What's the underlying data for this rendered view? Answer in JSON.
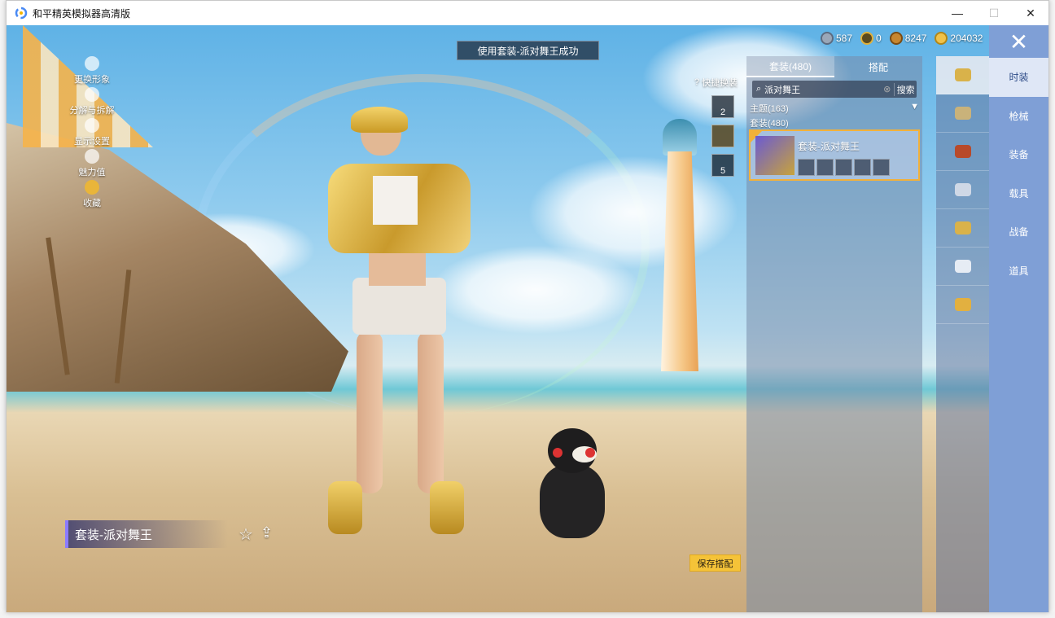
{
  "window": {
    "title": "和平精英模拟器高清版",
    "minimize": "—",
    "maximize": "☐",
    "close": "✕"
  },
  "toast": "使用套装-派对舞王成功",
  "currency": [
    {
      "icon": "silver-coin-icon",
      "value": "587",
      "color": "#9aa7b8"
    },
    {
      "icon": "bp-coin-icon",
      "value": "0",
      "color": "#e0b03a"
    },
    {
      "icon": "uc-coin-icon",
      "value": "8247",
      "color": "#c7862f"
    },
    {
      "icon": "gold-coin-icon",
      "value": "204032",
      "color": "#f0c24a"
    }
  ],
  "left_menu": [
    {
      "label": "更换形象"
    },
    {
      "label": "分解与拆解"
    },
    {
      "label": "显示设置"
    },
    {
      "label": "魅力值"
    },
    {
      "label": "收藏"
    }
  ],
  "quick_swap": {
    "label": "快捷换装",
    "slots": [
      "2",
      "",
      "5"
    ]
  },
  "panel": {
    "tabs": [
      "套装(480)",
      "搭配"
    ],
    "search_value": "派对舞王",
    "search_button": "搜索",
    "theme_label": "主题(163)",
    "theme_arrow": "▼",
    "suit_count": "套装(480)",
    "suit_card_name": "套装-派对舞王"
  },
  "categories": [
    "时装",
    "枪械",
    "装备",
    "载具",
    "战备",
    "道具"
  ],
  "outfit_label": "套装-派对舞王",
  "save_button": "保存搭配",
  "colors": {
    "accent_blue": "#7f9fd6",
    "save_yellow": "#f5c338",
    "selected_border": "#f2b13a"
  }
}
